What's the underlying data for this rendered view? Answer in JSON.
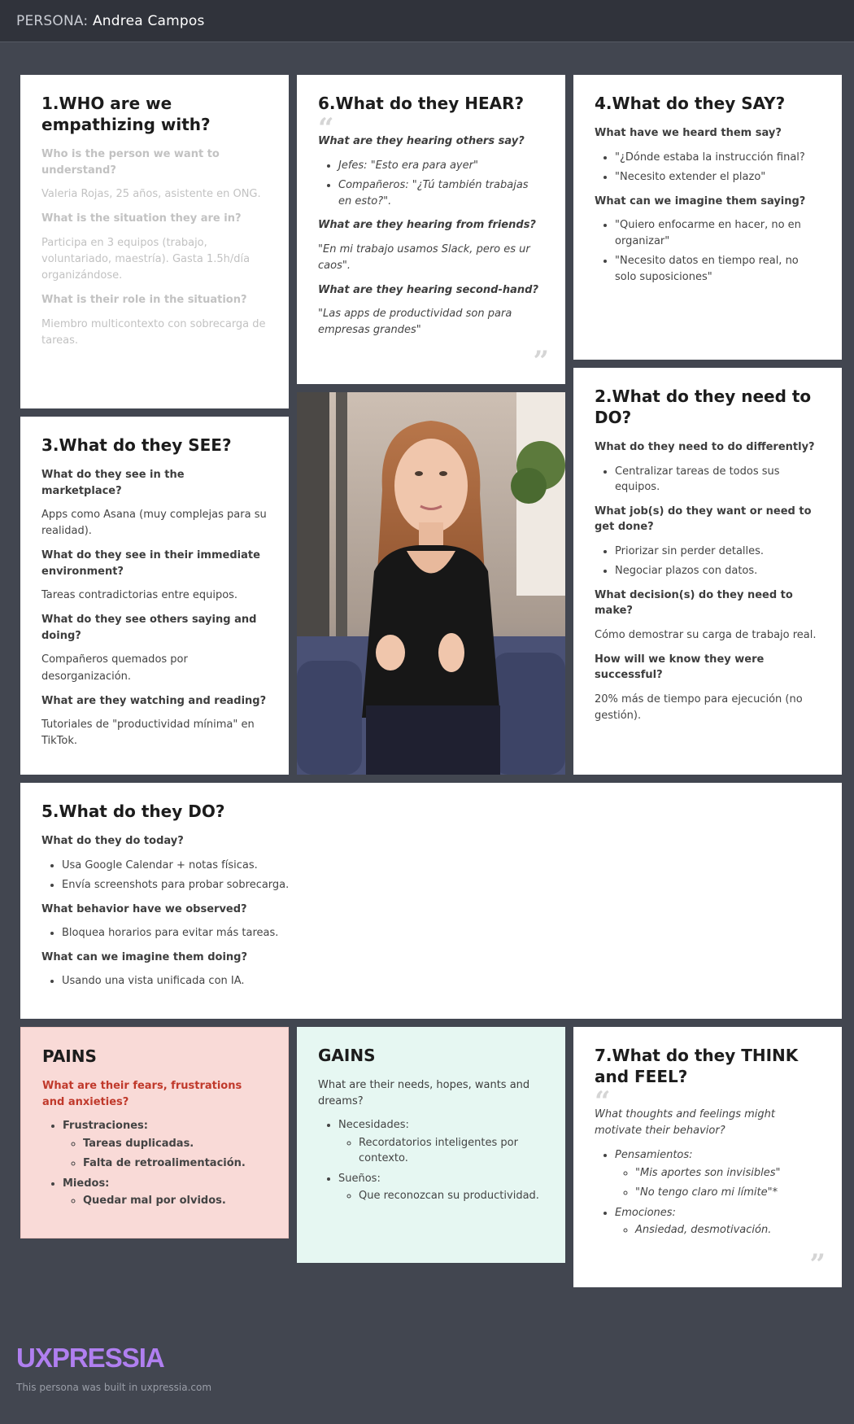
{
  "header": {
    "prefix": "PERSONA:",
    "name": "Andrea Campos"
  },
  "who": {
    "title": "1.WHO are we empathizing with?",
    "q1": "Who is the person we want to understand?",
    "a1": "Valeria Rojas, 25 años, asistente en ONG.",
    "q2": "What is the situation they are in?",
    "a2": "Participa en 3 equipos (trabajo, voluntariado, maestría). Gasta 1.5h/día organizándose.",
    "q3": "What is their role in the situation?",
    "a3": "Miembro multicontexto con sobrecarga de tareas."
  },
  "hear": {
    "title": "6.What do they HEAR?",
    "q1": "What are they hearing others say?",
    "items1": [
      "Jefes: \"Esto era para ayer\"",
      "Compañeros: \"¿Tú también trabajas en esto?\"."
    ],
    "q2": "What are they hearing from friends?",
    "a2": "\"En mi trabajo usamos Slack, pero es ur caos\".",
    "q3": "What are they hearing second-hand?",
    "a3": "\"Las apps de productividad son para empresas grandes\""
  },
  "say": {
    "title": "4.What do they SAY?",
    "q1": "What have we heard them say?",
    "items1": [
      "\"¿Dónde estaba la instrucción final?",
      "\"Necesito extender el plazo\""
    ],
    "q2": "What can we imagine them saying?",
    "items2": [
      "\"Quiero enfocarme en hacer, no en organizar\"",
      "\"Necesito datos en tiempo real, no solo suposiciones\""
    ]
  },
  "see": {
    "title": "3.What do they SEE?",
    "q1": "What do they see in the marketplace?",
    "a1": "Apps como Asana (muy complejas para su realidad).",
    "q2": "What do they see in their immediate environment?",
    "a2": "Tareas contradictorias entre equipos.",
    "q3": "What do they see others saying and doing?",
    "a3": "Compañeros quemados por desorganización.",
    "q4": "What are they watching and reading?",
    "a4": "Tutoriales de \"productividad mínima\" en TikTok."
  },
  "need": {
    "title": "2.What do they need to DO?",
    "q1": "What do they need to do differently?",
    "items1": [
      "Centralizar tareas de todos sus equipos."
    ],
    "q2": "What job(s) do they want or need to get done?",
    "items2": [
      "Priorizar sin perder detalles.",
      "Negociar plazos con datos."
    ],
    "q3": "What decision(s) do they need to make?",
    "a3": "Cómo demostrar su carga de trabajo real.",
    "q4": "How will we know they were successful?",
    "a4": "20% más de tiempo para ejecución (no gestión)."
  },
  "do": {
    "title": "5.What do they DO?",
    "q1": "What do they do today?",
    "items1": [
      "Usa Google Calendar + notas físicas.",
      "Envía screenshots para probar sobrecarga."
    ],
    "q2": "What behavior have we observed?",
    "items2": [
      "Bloquea horarios para evitar más tareas."
    ],
    "q3": "What can we imagine them doing?",
    "items3": [
      "Usando una vista unificada con IA."
    ]
  },
  "pains": {
    "title": "PAINS",
    "question": "What are their fears, frustrations and anxieties?",
    "group1": "Frustraciones:",
    "group1_items": [
      "Tareas duplicadas.",
      "Falta de retroalimentación."
    ],
    "group2": "Miedos:",
    "group2_items": [
      "Quedar mal por olvidos."
    ]
  },
  "gains": {
    "title": "GAINS",
    "question": "What are their needs, hopes, wants and dreams?",
    "group1": "Necesidades:",
    "group1_items": [
      "Recordatorios inteligentes por contexto."
    ],
    "group2": "Sueños:",
    "group2_items": [
      "Que reconozcan su productividad."
    ]
  },
  "think": {
    "title": "7.What do they THINK and FEEL?",
    "question": "What thoughts and feelings might motivate their behavior?",
    "group1": "Pensamientos:",
    "group1_items": [
      "\"Mis aportes son invisibles\"",
      "\"No tengo claro mi límite\"*"
    ],
    "group2": "Emociones:",
    "group2_items": [
      "Ansiedad, desmotivación."
    ]
  },
  "photo": {
    "alt": "persona-photo"
  },
  "footer": {
    "logo": "UXPRESSIA",
    "text": "This persona was built in uxpressia.com"
  },
  "colors": {
    "background": "#424650",
    "pains_bg": "#f9dad7",
    "pains_text": "#c0392b",
    "gains_bg": "#e6f7f2",
    "logo": "#b07ff0"
  }
}
